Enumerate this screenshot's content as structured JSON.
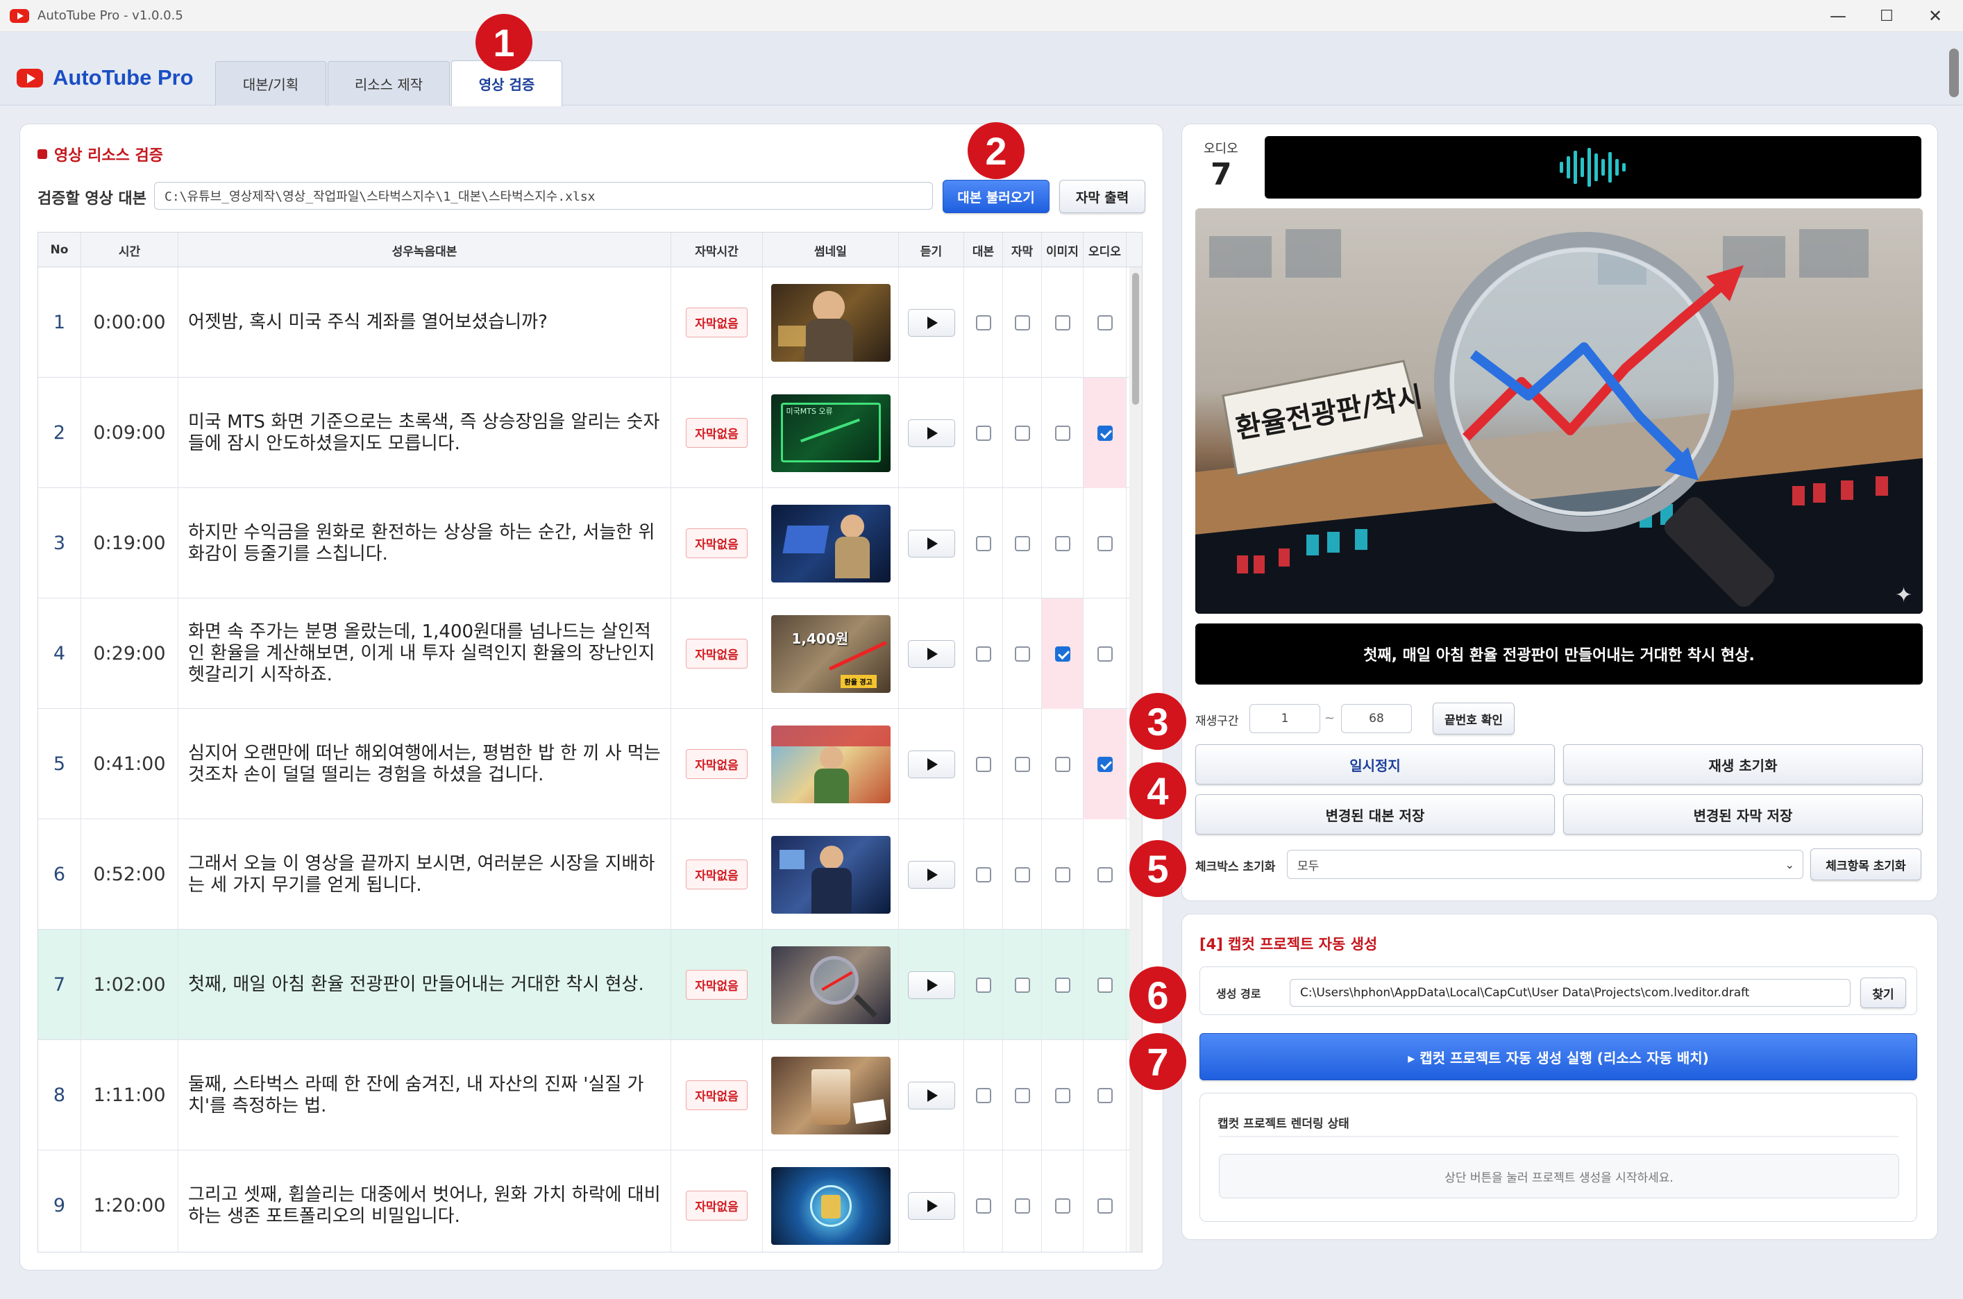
{
  "window": {
    "title": "AutoTube Pro - v1.0.0.5",
    "minimize": "—",
    "maximize": "☐",
    "close": "✕"
  },
  "brand": "AutoTube Pro",
  "tabs": [
    "대본/기획",
    "리소스 제작",
    "영상 검증"
  ],
  "badges": [
    "1",
    "2",
    "3",
    "4",
    "5",
    "6",
    "7"
  ],
  "verify": {
    "title": "영상 리소스 검증",
    "script_label": "검증할 영상 대본",
    "script_path": "C:\\유튜브_영상제작\\영상_작업파일\\스타벅스지수\\1_대본\\스타벅스지수.xlsx",
    "load_btn": "대본 불러오기",
    "subtitle_btn": "자막 출력"
  },
  "table": {
    "headers": [
      "No",
      "시간",
      "성우녹음대본",
      "자막시간",
      "썸네일",
      "듣기",
      "대본",
      "자막",
      "이미지",
      "오디오"
    ],
    "rows": [
      {
        "no": "1",
        "time": "0:00:00",
        "text": "어젯밤, 혹시 미국 주식 계좌를 열어보셨습니까?",
        "sub": "자막없음",
        "img": false,
        "audio": false
      },
      {
        "no": "2",
        "time": "0:09:00",
        "text": "미국 MTS 화면 기준으로는 초록색, 즉 상승장임을 알리는 숫자들에 잠시 안도하셨을지도 모릅니다.",
        "sub": "자막없음",
        "img": false,
        "audio": true
      },
      {
        "no": "3",
        "time": "0:19:00",
        "text": "하지만 수익금을 원화로 환전하는 상상을 하는 순간, 서늘한 위화감이 등줄기를 스칩니다.",
        "sub": "자막없음",
        "img": false,
        "audio": false
      },
      {
        "no": "4",
        "time": "0:29:00",
        "text": "화면 속 주가는 분명 올랐는데, 1,400원대를 넘나드는 살인적인 환율을 계산해보면, 이게 내 투자 실력인지 환율의 장난인지 헷갈리기 시작하죠.",
        "sub": "자막없음",
        "img": true,
        "audio": false
      },
      {
        "no": "5",
        "time": "0:41:00",
        "text": "심지어 오랜만에 떠난 해외여행에서는, 평범한 밥 한 끼 사 먹는 것조차 손이 덜덜 떨리는 경험을 하셨을 겁니다.",
        "sub": "자막없음",
        "img": false,
        "audio": true
      },
      {
        "no": "6",
        "time": "0:52:00",
        "text": "그래서 오늘 이 영상을 끝까지 보시면, 여러분은 시장을 지배하는 세 가지 무기를 얻게 됩니다.",
        "sub": "자막없음",
        "img": false,
        "audio": false
      },
      {
        "no": "7",
        "time": "1:02:00",
        "text": "첫째, 매일 아침 환율 전광판이 만들어내는 거대한 착시 현상.",
        "sub": "자막없음",
        "img": false,
        "audio": false
      },
      {
        "no": "8",
        "time": "1:11:00",
        "text": "둘째, 스타벅스 라떼 한 잔에 숨겨진, 내 자산의 진짜 '실질 가치'를 측정하는 법.",
        "sub": "자막없음",
        "img": false,
        "audio": false
      },
      {
        "no": "9",
        "time": "1:20:00",
        "text": "그리고 셋째, 휩쓸리는 대중에서 벗어나, 원화 가치 하락에 대비하는 생존 포트폴리오의 비밀입니다.",
        "sub": "자막없음",
        "img": false,
        "audio": false
      }
    ],
    "thumb_texts": {
      "r2": "미국MTS 오류",
      "r4": "1,400원",
      "r4b": "환율 경고"
    }
  },
  "preview": {
    "audio_label": "오디오",
    "audio_no": "7",
    "image_sign": "환율전광판/착시",
    "caption": "첫째, 매일 아침 환율 전광판이 만들어내는 거대한 착시 현상.",
    "range_label": "재생구간",
    "range_from": "1",
    "range_sep": "~",
    "range_to": "68",
    "confirm_btn": "끝번호 확인",
    "pause_btn": "일시정지",
    "reset_btn": "재생 초기화",
    "save_script_btn": "변경된 대본 저장",
    "save_sub_btn": "변경된 자막 저장",
    "checkbox_reset_label": "체크박스 초기화",
    "checkbox_reset_value": "모두",
    "checkbox_reset_btn": "체크항목 초기화"
  },
  "capcut": {
    "title": "[4] 캡컷 프로젝트 자동 생성",
    "path_label": "생성 경로",
    "path_value": "C:\\Users\\hphon\\AppData\\Local\\CapCut\\User Data\\Projects\\com.lveditor.draft",
    "find_btn": "찾기",
    "run_btn": "▸  캡컷 프로젝트 자동 생성 실행 (리소스 자동 배치)",
    "status_title": "캡컷 프로젝트 렌더링 상태",
    "status_msg": "상단 버튼을 눌러 프로젝트 생성을 시작하세요."
  }
}
